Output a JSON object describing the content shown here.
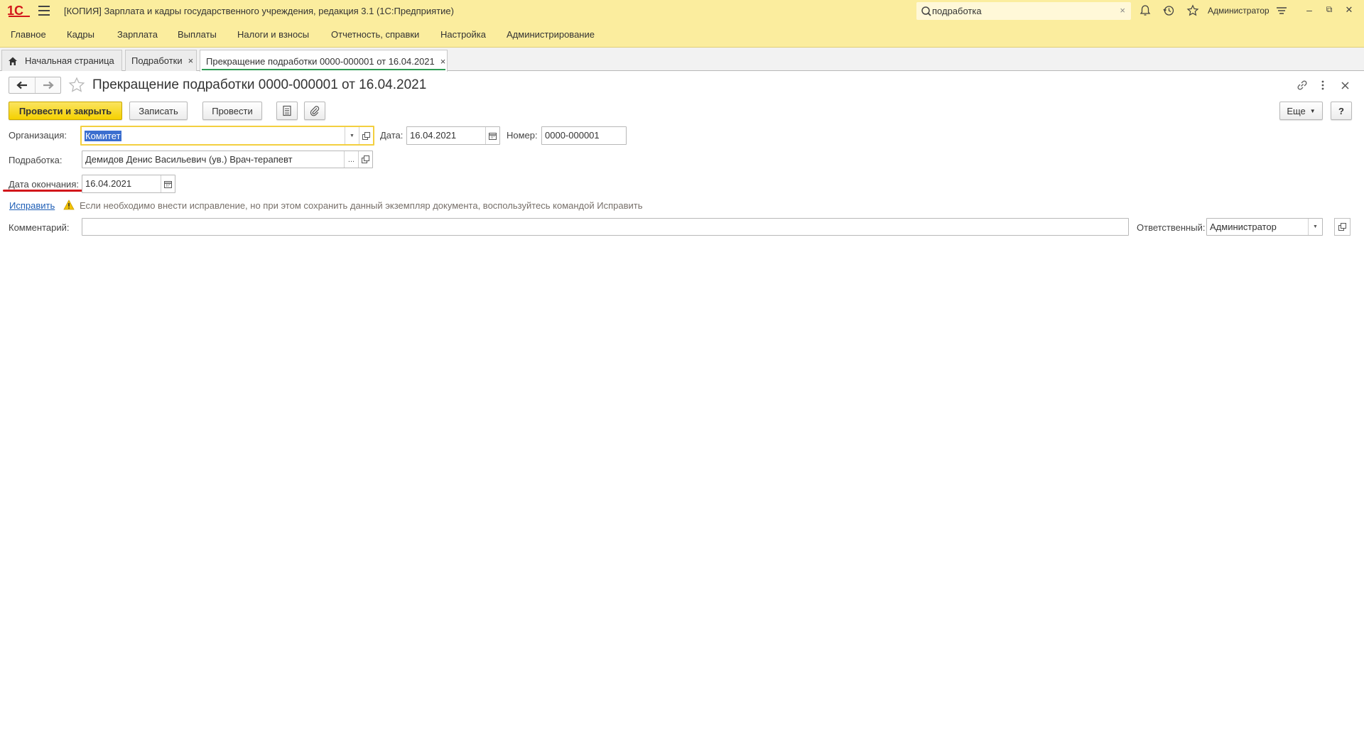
{
  "titlebar": {
    "logo_text": "1С",
    "app_title": "[КОПИЯ] Зарплата и кадры государственного учреждения, редакция 3.1  (1С:Предприятие)",
    "search_value": "подработка",
    "search_clear": "×",
    "user_name": "Администратор",
    "window_buttons": [
      "–",
      "⧉",
      "✕"
    ]
  },
  "sections": [
    "Главное",
    "Кадры",
    "Зарплата",
    "Выплаты",
    "Налоги и взносы",
    "Отчетность, справки",
    "Настройка",
    "Администрирование"
  ],
  "tabs": [
    {
      "label": "Начальная страница"
    },
    {
      "label": "Подработки",
      "close": "×"
    },
    {
      "label": "Прекращение подработки 0000-000001 от 16.04.2021",
      "close": "×"
    }
  ],
  "form": {
    "title": "Прекращение подработки 0000-000001 от 16.04.2021",
    "buttons": {
      "post_and_close": "Провести и закрыть",
      "save": "Записать",
      "post": "Провести",
      "more": "Еще",
      "help": "?"
    },
    "fields": {
      "organization_label": "Организация:",
      "organization_value": "Комитет",
      "date_label": "Дата:",
      "date_value": "16.04.2021",
      "number_label": "Номер:",
      "number_value": "0000-000001",
      "sidejob_label": "Подработка:",
      "sidejob_value": "Демидов Денис Васильевич (ув.) Врач-терапевт",
      "end_date_label": "Дата окончания:",
      "end_date_value": "16.04.2021",
      "fix_link": "Исправить",
      "warning": "Если необходимо внести исправление, но при этом сохранить данный экземпляр документа, воспользуйтесь командой Исправить",
      "comment_label": "Комментарий:",
      "comment_value": "",
      "responsible_label": "Ответственный:",
      "responsible_value": "Администратор"
    }
  },
  "colors": {
    "header_bg": "#fbed9e",
    "primary_button": "#f5d100",
    "active_tab_underline": "#2f9c55",
    "focus_border": "#f3cf40",
    "highlight_underline": "#d2161b",
    "link": "#1f5fb6"
  }
}
